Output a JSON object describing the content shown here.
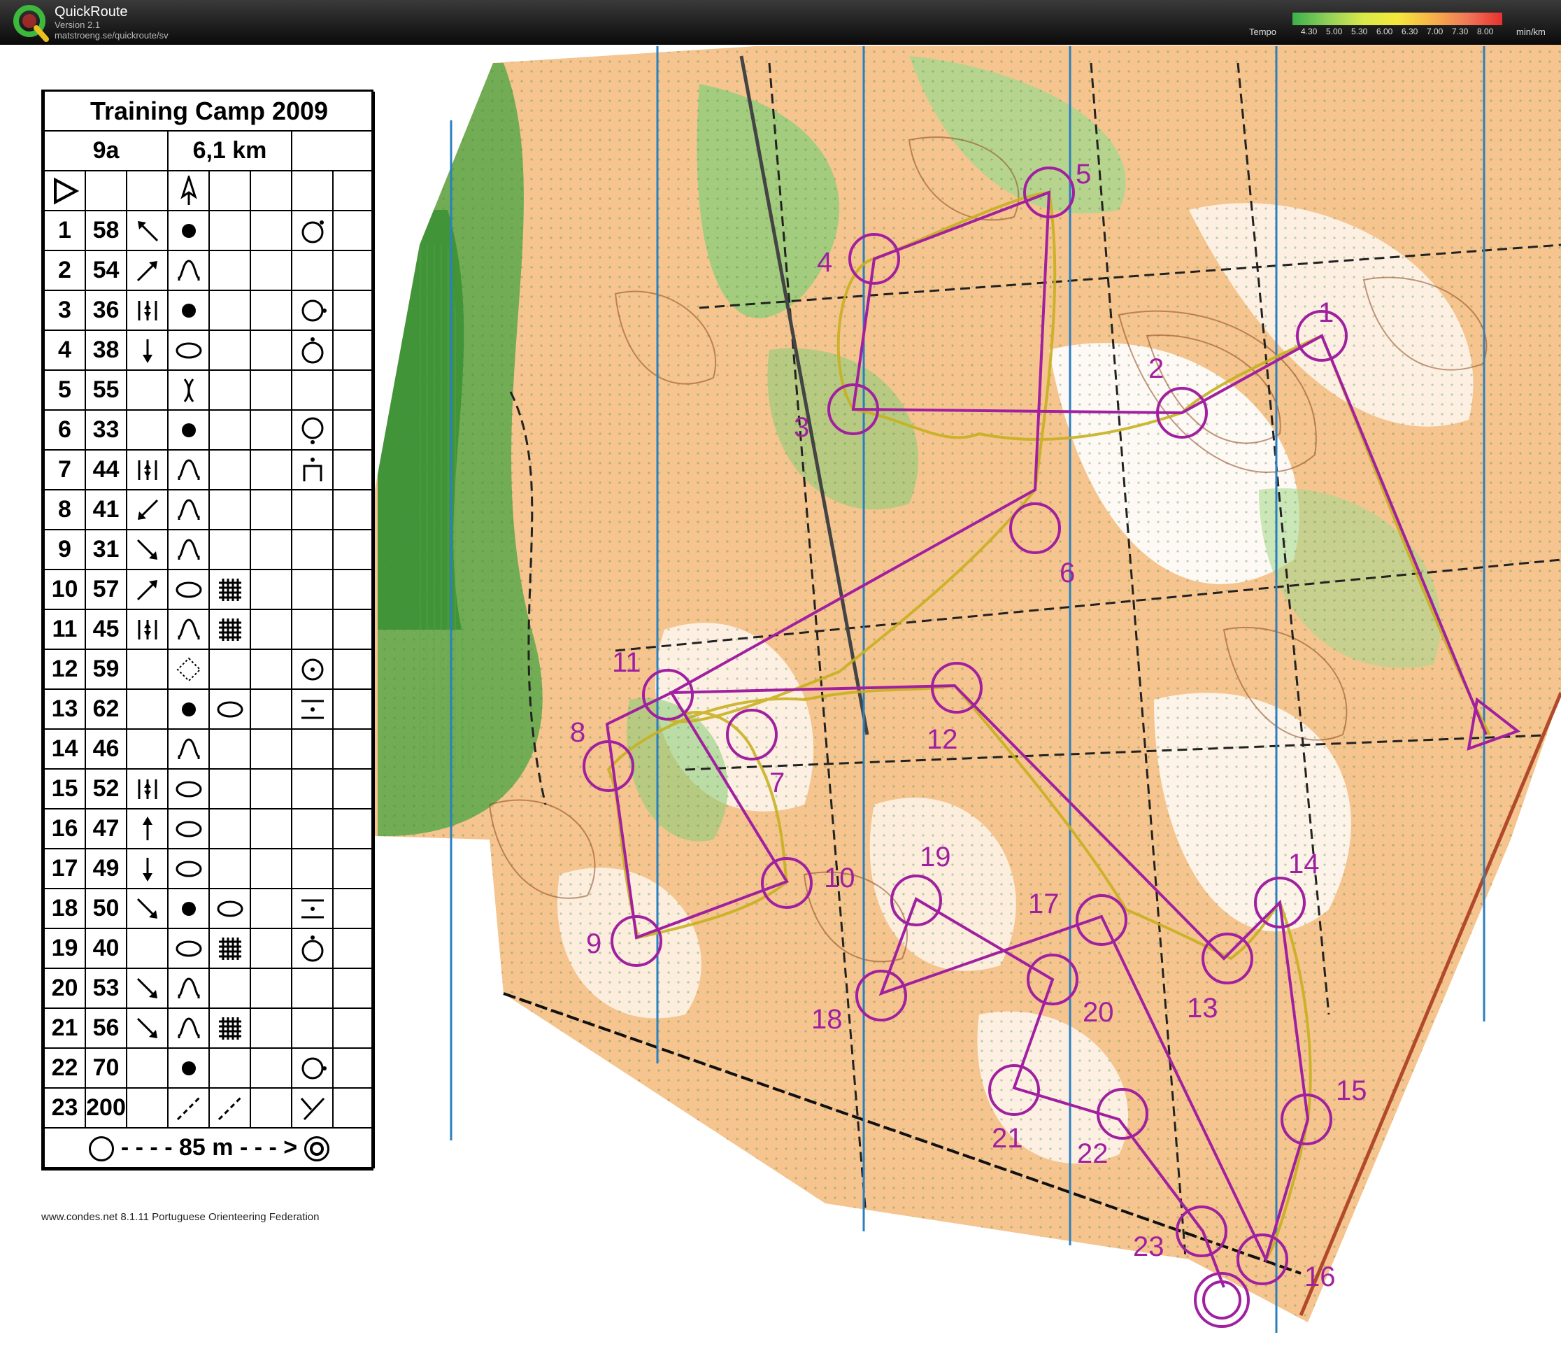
{
  "app": {
    "name": "QuickRoute",
    "version": "Version 2.1",
    "url": "matstroeng.se/quickroute/sv"
  },
  "tempo": {
    "label": "Tempo",
    "ticks": [
      "4.30",
      "5.00",
      "5.30",
      "6.00",
      "6.30",
      "7.00",
      "7.30",
      "8.00"
    ],
    "unit": "min/km"
  },
  "description": {
    "title": "Training Camp 2009",
    "course": "9a",
    "length": "6,1 km",
    "rows": [
      {
        "n": "1",
        "code": "58"
      },
      {
        "n": "2",
        "code": "54"
      },
      {
        "n": "3",
        "code": "36"
      },
      {
        "n": "4",
        "code": "38"
      },
      {
        "n": "5",
        "code": "55"
      },
      {
        "n": "6",
        "code": "33"
      },
      {
        "n": "7",
        "code": "44"
      },
      {
        "n": "8",
        "code": "41"
      },
      {
        "n": "9",
        "code": "31"
      },
      {
        "n": "10",
        "code": "57"
      },
      {
        "n": "11",
        "code": "45"
      },
      {
        "n": "12",
        "code": "59"
      },
      {
        "n": "13",
        "code": "62"
      },
      {
        "n": "14",
        "code": "46"
      },
      {
        "n": "15",
        "code": "52"
      },
      {
        "n": "16",
        "code": "47"
      },
      {
        "n": "17",
        "code": "49"
      },
      {
        "n": "18",
        "code": "50"
      },
      {
        "n": "19",
        "code": "40"
      },
      {
        "n": "20",
        "code": "53"
      },
      {
        "n": "21",
        "code": "56"
      },
      {
        "n": "22",
        "code": "70"
      },
      {
        "n": "23",
        "code": "200"
      }
    ],
    "finish": "85 m"
  },
  "controls": [
    "1",
    "2",
    "3",
    "4",
    "5",
    "6",
    "7",
    "8",
    "9",
    "10",
    "11",
    "12",
    "13",
    "14",
    "15",
    "16",
    "17",
    "18",
    "19",
    "20",
    "21",
    "22",
    "23"
  ],
  "footer": "www.condes.net 8.1.11 Portuguese Orienteering Federation",
  "colors": {
    "course": "#a020a0",
    "route": "#c8b020",
    "forest": "#5aa84a",
    "open": "#f6c48e",
    "magnetic": "#2a7fc0"
  }
}
